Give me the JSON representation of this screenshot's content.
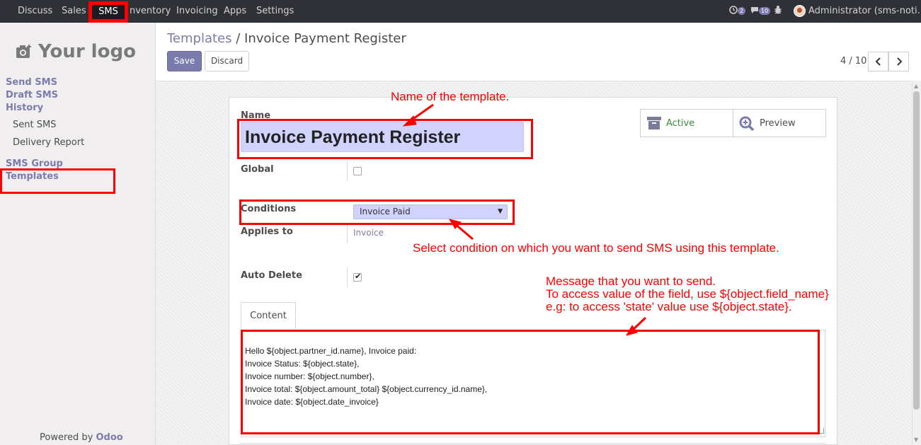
{
  "navbar": {
    "menus": [
      "Discuss",
      "Sales",
      "SMS",
      "Inventory",
      "Invoicing",
      "Apps",
      "Settings"
    ],
    "inventory_visible": "nventory",
    "chat_badge": "2",
    "messages_badge": "10",
    "user": "Administrator (sms-noti…"
  },
  "sidebar": {
    "logo_text": "Your logo",
    "items": [
      {
        "label": "Send SMS"
      },
      {
        "label": "Draft SMS"
      },
      {
        "label": "History"
      },
      {
        "label": "Sent SMS"
      },
      {
        "label": "Delivery Report"
      },
      {
        "label": "SMS Group"
      },
      {
        "label": "Templates"
      }
    ],
    "powered_prefix": "Powered by ",
    "powered_brand": "Odoo"
  },
  "control": {
    "breadcrumb_link": "Templates",
    "breadcrumb_sep": " / ",
    "breadcrumb_current": "Invoice Payment Register",
    "save_label": "Save",
    "discard_label": "Discard",
    "pager": "4 / 10",
    "prev": "‹",
    "next": "›"
  },
  "form": {
    "name_label": "Name",
    "name_value": "Invoice Payment Register",
    "global_label": "Global",
    "global_checked": false,
    "conditions_label": "Conditions",
    "conditions_value": "Invoice Paid",
    "applies_label": "Applies to",
    "applies_value": "Invoice",
    "auto_delete_label": "Auto Delete",
    "auto_delete_checked": true,
    "active_label": "Active",
    "preview_label": "Preview",
    "tab_content": "Content",
    "content": "Hello ${object.partner_id.name}, Invoice paid:\nInvoice Status: ${object.state},\nInvoice number: ${object.number},\nInvoice total: ${object.amount_total} ${object.currency_id.name},\nInvoice date: ${object.date_invoice}"
  },
  "annotations": {
    "name_note": "Name of the template.",
    "condition_note": "Select condition on which you want to send SMS using this template.",
    "message_note_1": "Message that you want to send.",
    "message_note_2": "To access value of the field, use ${object.field_name}",
    "message_note_3": "e.g: to access 'state' value use ${object.state}.",
    "color": "#ff0000"
  },
  "colors": {
    "navbar": "#2f3136",
    "accent": "#7c7bad",
    "field_bg": "#d2d2ff",
    "active": "#3b8a3b"
  }
}
